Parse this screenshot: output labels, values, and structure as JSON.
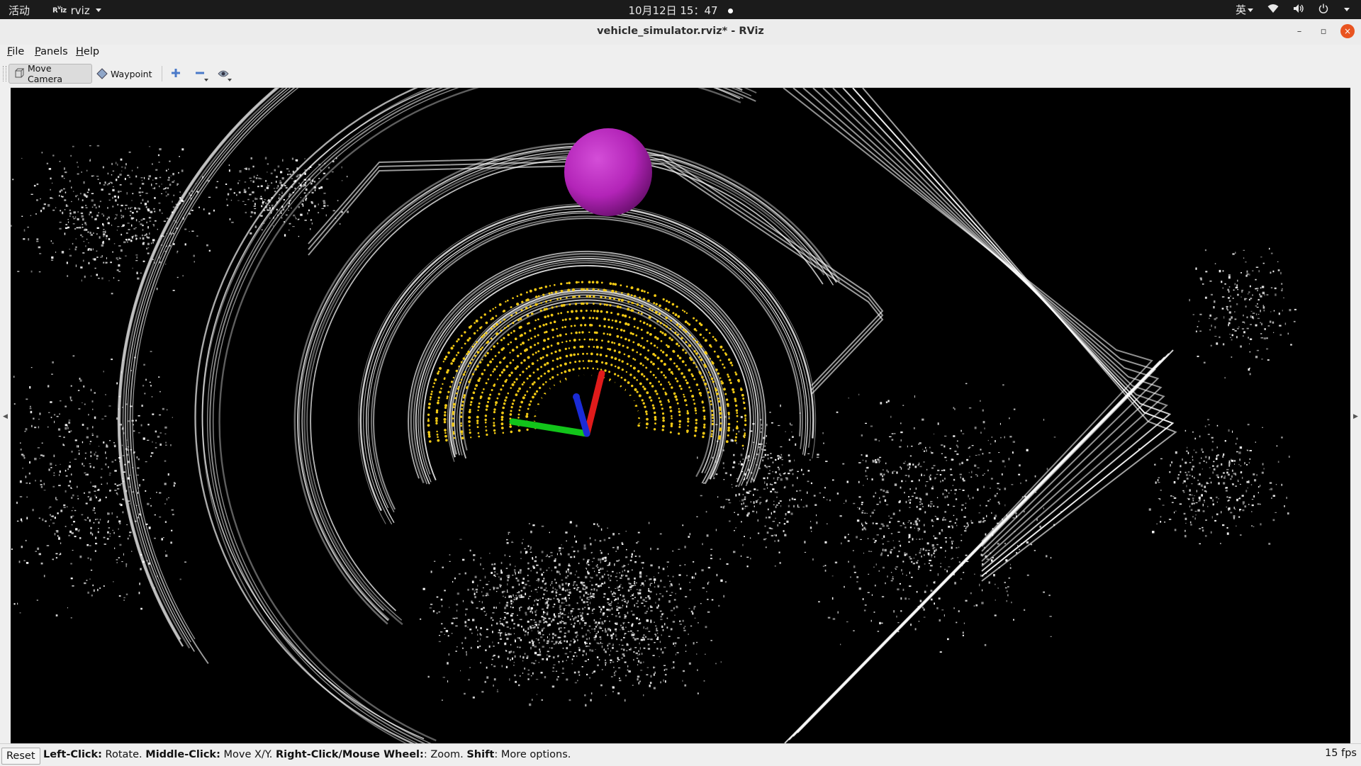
{
  "topbar": {
    "activities": "活动",
    "app_name": "rviz",
    "clock": "10月12日  15：47",
    "input_method": "英"
  },
  "window": {
    "title": "vehicle_simulator.rviz* - RViz",
    "minimize": "–",
    "maximize": "▫",
    "close": "×"
  },
  "menu": {
    "file_u": "F",
    "file_rest": "ile",
    "panels_u": "P",
    "panels_rest": "anels",
    "help_u": "H",
    "help_rest": "elp"
  },
  "toolbar": {
    "move_camera": "Move Camera",
    "waypoint": "Waypoint",
    "icons": [
      "move-camera-icon",
      "waypoint-icon",
      "add-tool-icon",
      "remove-tool-icon",
      "eye-icon"
    ]
  },
  "status": {
    "reset": "Reset",
    "hint_left_b": "Left-Click:",
    "hint_left": " Rotate. ",
    "hint_middle_b": "Middle-Click:",
    "hint_middle": " Move X/Y. ",
    "hint_right_b": "Right-Click/Mouse Wheel:",
    "hint_right": ": Zoom. ",
    "hint_shift_b": "Shift",
    "hint_shift": ": More options.",
    "fps": "15 fps"
  },
  "colors": {
    "goal_sphere": "#b324b8",
    "scan_points": "#f2c914",
    "axis_x": "#e01b1b",
    "axis_y": "#12c41a",
    "axis_z": "#1a2bd6",
    "close_button": "#e95420"
  }
}
